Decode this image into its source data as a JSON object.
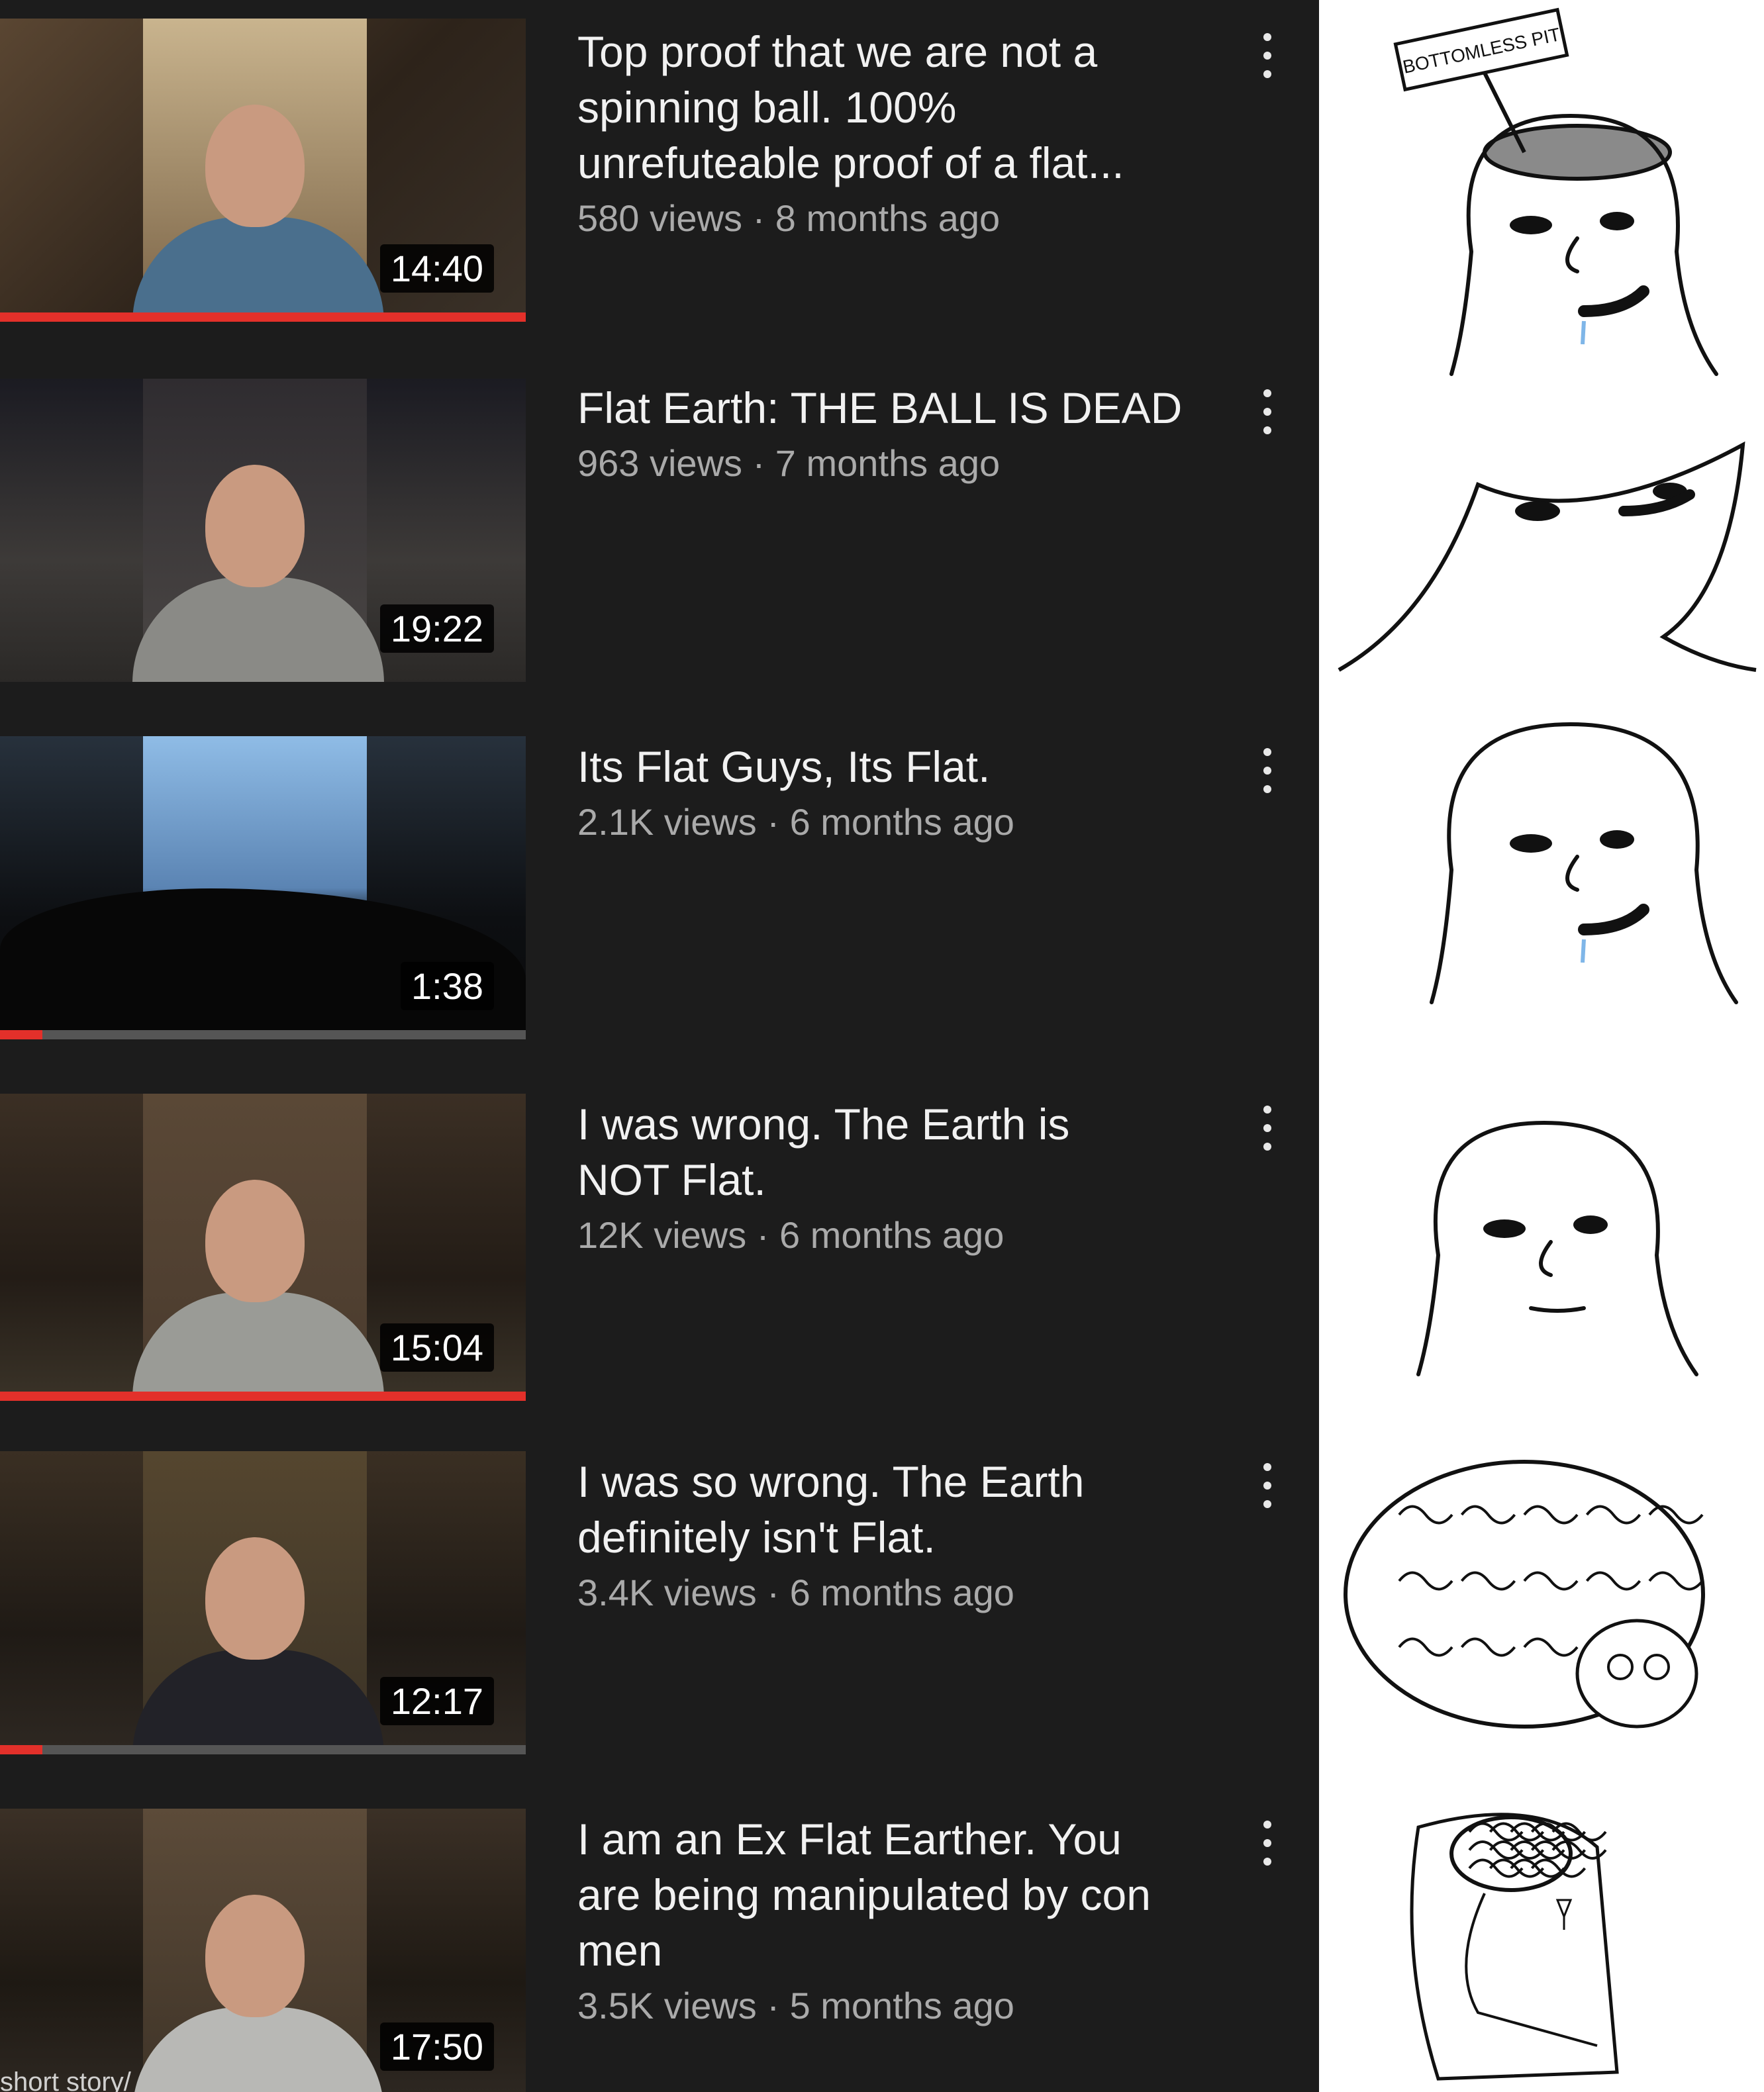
{
  "videos": [
    {
      "title": "Top proof that we are not a\nspinning ball. 100%\nunrefuteable proof of a flat...",
      "views": "580 views",
      "age": "8 months ago",
      "duration": "14:40",
      "watched_fraction": 1.0,
      "thumbnail_icon": "man-in-cap-thumbnail"
    },
    {
      "title": "Flat Earth: THE BALL IS DEAD",
      "views": "963 views",
      "age": "7 months ago",
      "duration": "19:22",
      "watched_fraction": 0,
      "thumbnail_icon": "bald-man-thumbnail"
    },
    {
      "title": "Its Flat Guys, Its Flat.",
      "views": "2.1K views",
      "age": "6 months ago",
      "duration": "1:38",
      "watched_fraction": 0.08,
      "thumbnail_icon": "sky-treeline-thumbnail"
    },
    {
      "title": "I was wrong. The Earth is\nNOT Flat.",
      "views": "12K views",
      "age": "6 months ago",
      "duration": "15:04",
      "watched_fraction": 1.0,
      "thumbnail_icon": "man-in-cap-thumbnail"
    },
    {
      "title": "I was so wrong. The Earth\ndefinitely isn't Flat.",
      "views": "3.4K views",
      "age": "6 months ago",
      "duration": "12:17",
      "watched_fraction": 0.08,
      "thumbnail_icon": "man-in-cap-thumbnail"
    },
    {
      "title": "I am an Ex Flat Earther. You\nare being manipulated by con\nmen",
      "views": "3.5K views",
      "age": "5 months ago",
      "duration": "17:50",
      "watched_fraction": 0,
      "thumbnail_icon": "man-in-hoodie-thumbnail",
      "thumbnail_caption": "short story/"
    }
  ],
  "separator": " · ",
  "colors": {
    "background": "#1c1c1c",
    "title": "#f1f1f1",
    "subtitle": "#aaaaaa",
    "progress": "#e3302a"
  },
  "meme_panels": [
    {
      "name": "bottomless-pit-wojak",
      "sign_text": "BOTTOMLESS PIT"
    },
    {
      "name": "flat-head-wojak"
    },
    {
      "name": "smooth-brain-wojak"
    },
    {
      "name": "regular-wojak"
    },
    {
      "name": "big-brain-wojak"
    },
    {
      "name": "galaxy-brain-throne-wojak"
    }
  ]
}
